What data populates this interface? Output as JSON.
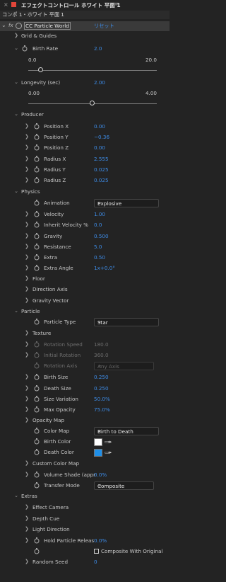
{
  "window": {
    "title": "エフェクトコントロール ホワイト 平面 1"
  },
  "comp_bar": {
    "label": "コンポ 1・ホワイト 平面 1"
  },
  "effect": {
    "fx": "fx",
    "name": "CC Particle World",
    "reset": "リセット"
  },
  "grid_guides": "Grid & Guides",
  "birth_rate": {
    "label": "Birth Rate",
    "value": "2.0",
    "min": "0.0",
    "max": "20.0",
    "pos": 0.1
  },
  "longevity": {
    "label": "Longevity (sec)",
    "value": "2.00",
    "min": "0.00",
    "max": "4.00",
    "pos": 0.5
  },
  "producer": {
    "label": "Producer",
    "position_x": {
      "label": "Position X",
      "value": "0.00"
    },
    "position_y": {
      "label": "Position Y",
      "value": "−0.36"
    },
    "position_z": {
      "label": "Position Z",
      "value": "0.00"
    },
    "radius_x": {
      "label": "Radius X",
      "value": "2.555"
    },
    "radius_y": {
      "label": "Radius Y",
      "value": "0.025"
    },
    "radius_z": {
      "label": "Radius Z",
      "value": "0.025"
    }
  },
  "physics": {
    "label": "Physics",
    "animation": {
      "label": "Animation",
      "value": "Explosive"
    },
    "velocity": {
      "label": "Velocity",
      "value": "1.00"
    },
    "inherit_velocity": {
      "label": "Inherit Velocity %",
      "value": "0.0"
    },
    "gravity": {
      "label": "Gravity",
      "value": "0.500"
    },
    "resistance": {
      "label": "Resistance",
      "value": "5.0"
    },
    "extra": {
      "label": "Extra",
      "value": "0.50"
    },
    "extra_angle": {
      "label": "Extra Angle",
      "value": "1x+0.0°"
    },
    "floor": "Floor",
    "direction_axis": "Direction Axis",
    "gravity_vector": "Gravity Vector"
  },
  "particle": {
    "label": "Particle",
    "particle_type": {
      "label": "Particle Type",
      "value": "Star"
    },
    "texture": "Texture",
    "rotation_speed": {
      "label": "Rotation Speed",
      "value": "180.0"
    },
    "initial_rotation": {
      "label": "Initial Rotation",
      "value": "360.0"
    },
    "rotation_axis": {
      "label": "Rotation Axis",
      "value": "Any Axis"
    },
    "birth_size": {
      "label": "Birth Size",
      "value": "0.250"
    },
    "death_size": {
      "label": "Death Size",
      "value": "0.250"
    },
    "size_variation": {
      "label": "Size Variation",
      "value": "50.0%"
    },
    "max_opacity": {
      "label": "Max Opacity",
      "value": "75.0%"
    },
    "opacity_map": "Opacity Map",
    "color_map": {
      "label": "Color Map",
      "value": "Birth to Death"
    },
    "birth_color": {
      "label": "Birth Color",
      "color": "#ffffff"
    },
    "death_color": {
      "label": "Death Color",
      "color": "#1f8fe8"
    },
    "custom_color_map": "Custom Color Map",
    "volume_shade": {
      "label": "Volume Shade (appr",
      "value": "0.0%"
    },
    "transfer_mode": {
      "label": "Transfer Mode",
      "value": "Composite"
    }
  },
  "extras": {
    "label": "Extras",
    "effect_camera": "Effect Camera",
    "depth_cue": "Depth Cue",
    "light_direction": "Light Direction",
    "hold_particle_release": {
      "label": "Hold Particle Releas",
      "value": "0.0%"
    },
    "composite_with_original": "Composite With Original"
  },
  "random_seed": {
    "label": "Random Seed",
    "value": "0"
  }
}
